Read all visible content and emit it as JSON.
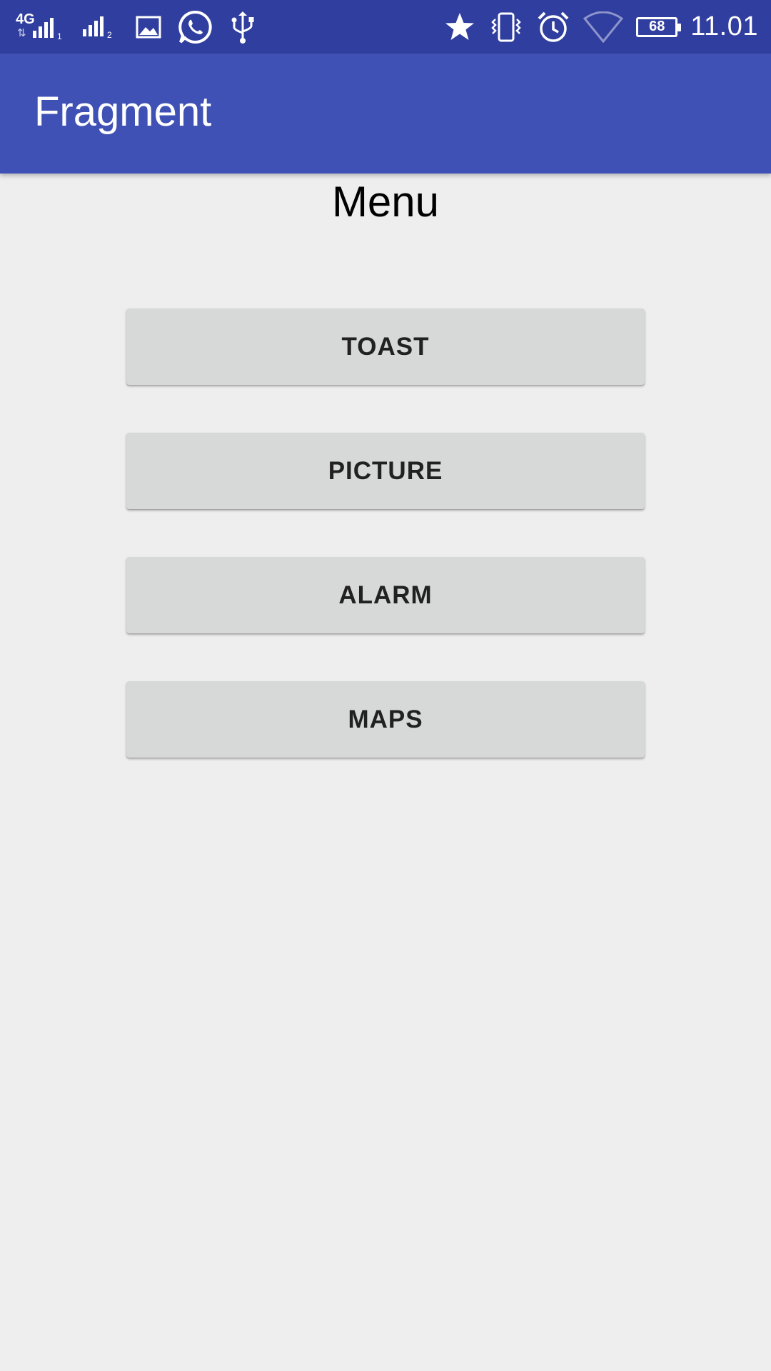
{
  "status_bar": {
    "network_label": "4G",
    "network_arrows": "⇅",
    "sim1": "1",
    "sim2": "2",
    "battery_level": "68",
    "time": "11.01",
    "icons": [
      "signal-icon",
      "signal-icon",
      "image-icon",
      "whatsapp-icon",
      "usb-icon",
      "star-icon",
      "vibrate-icon",
      "alarm-icon",
      "wifi-icon",
      "battery-icon"
    ]
  },
  "app_bar": {
    "title": "Fragment"
  },
  "main": {
    "heading": "Menu",
    "buttons": [
      {
        "label": "TOAST"
      },
      {
        "label": "PICTURE"
      },
      {
        "label": "ALARM"
      },
      {
        "label": "MAPS"
      }
    ]
  },
  "colors": {
    "status_bar": "#303f9f",
    "app_bar": "#3f51b5",
    "background": "#eeeeee",
    "button": "#d7d8d8",
    "button_text": "#212121"
  }
}
